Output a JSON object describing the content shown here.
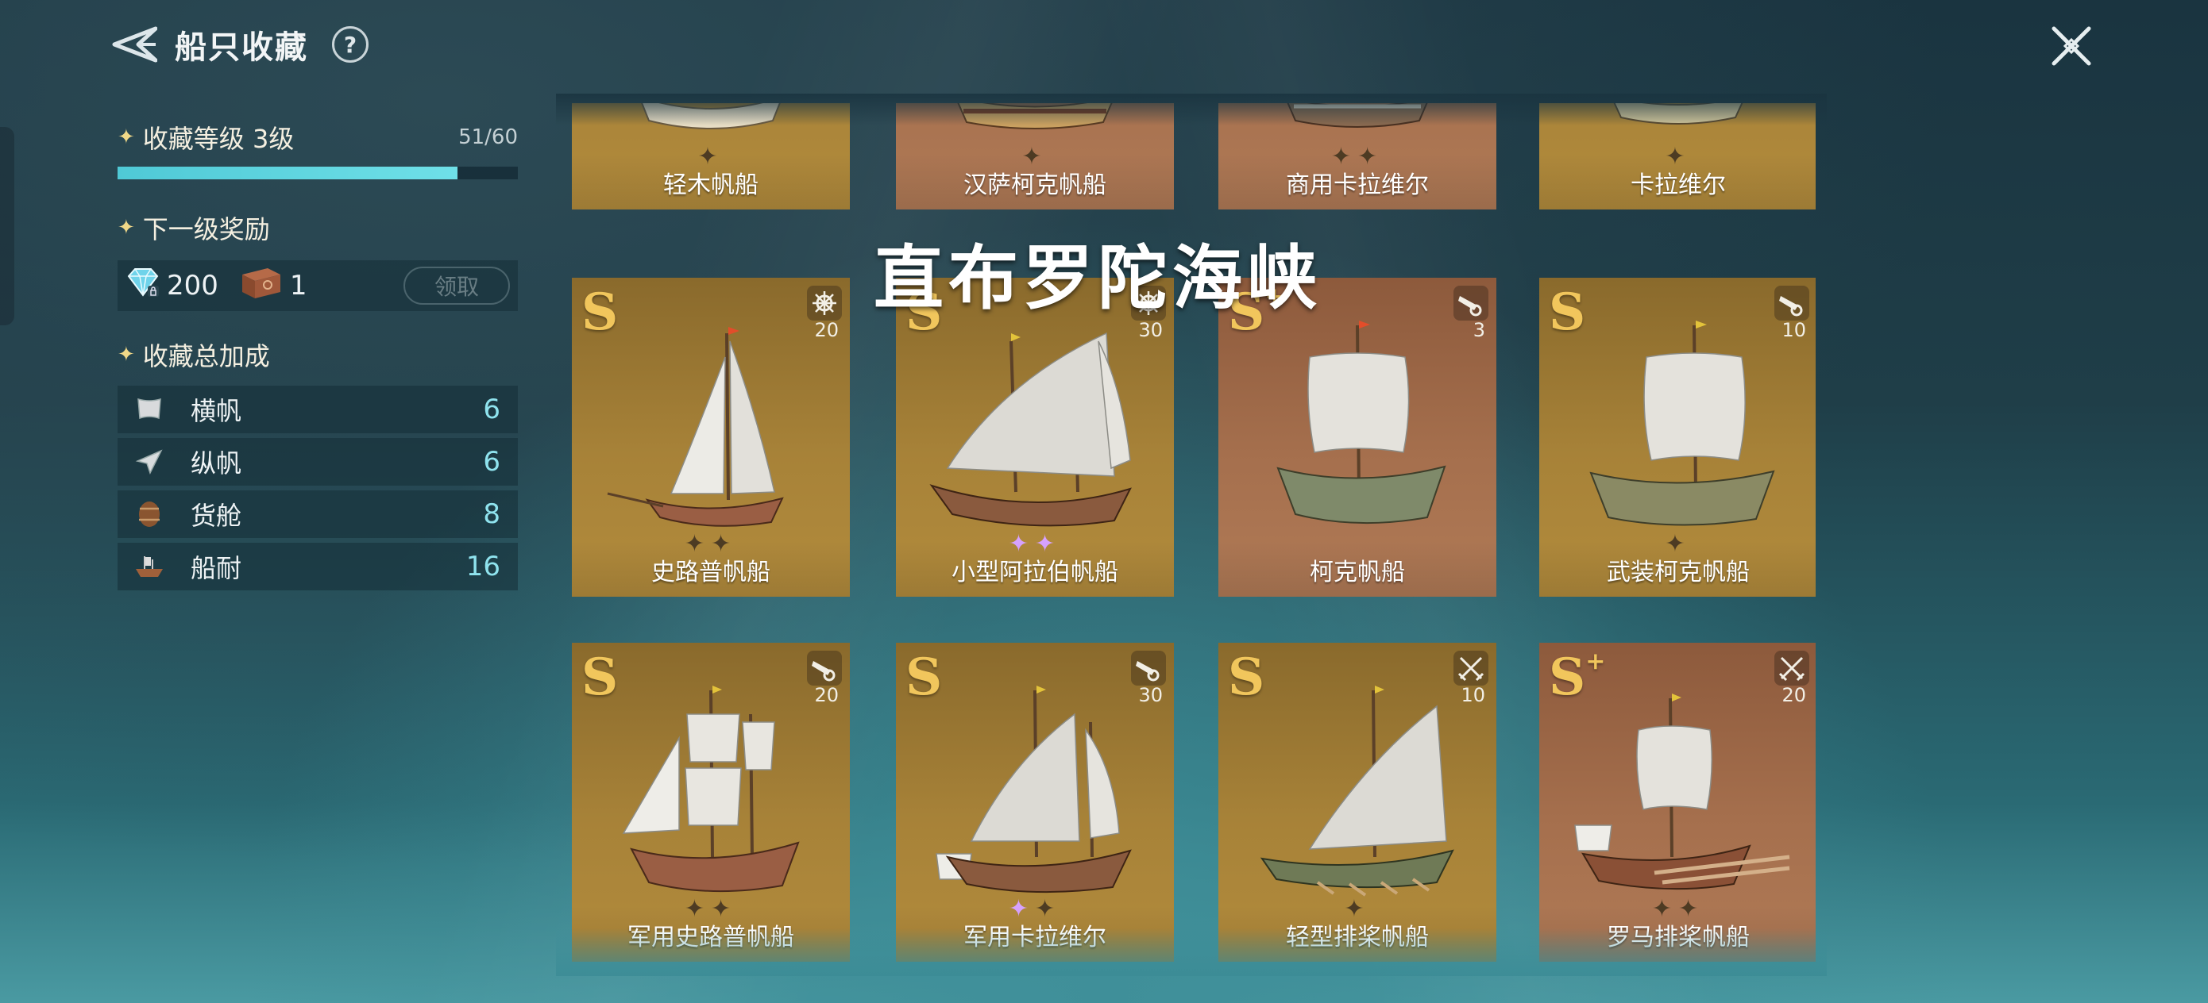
{
  "header": {
    "title": "船只收藏",
    "help": "?"
  },
  "collection": {
    "level_label": "收藏等级 3级",
    "level_count": "51/60",
    "progress": 0.85,
    "next_reward_label": "下一级奖励",
    "rewards": [
      {
        "icon": "diamond-icon",
        "amount": "200"
      },
      {
        "icon": "chest-icon",
        "amount": "1"
      }
    ],
    "claim_label": "领取",
    "bonus_label": "收藏总加成",
    "bonus": [
      {
        "icon": "square-sail-icon",
        "label": "横帆",
        "value": "6"
      },
      {
        "icon": "fore-aft-sail-icon",
        "label": "纵帆",
        "value": "6"
      },
      {
        "icon": "barrel-icon",
        "label": "货舱",
        "value": "8"
      },
      {
        "icon": "ship-hull-icon",
        "label": "船耐",
        "value": "16"
      }
    ]
  },
  "overlay": {
    "location": "直布罗陀海峡"
  },
  "ships": {
    "row0": [
      {
        "name": "轻木帆船",
        "stars": "✦"
      },
      {
        "name": "汉萨柯克帆船",
        "stars": "✦"
      },
      {
        "name": "商用卡拉维尔",
        "stars": "✦✦"
      },
      {
        "name": "卡拉维尔",
        "stars": "✦"
      }
    ],
    "row1": [
      {
        "grade": "S",
        "plus": "",
        "type_icon": "helm-icon",
        "type_num": "20",
        "name": "史路普帆船",
        "stars": "✦✦"
      },
      {
        "grade": "S",
        "plus": "",
        "type_icon": "helm-icon",
        "type_num": "30",
        "name": "小型阿拉伯帆船",
        "stars": "✦✦"
      },
      {
        "grade": "S",
        "plus": "+",
        "type_icon": "cannon-icon",
        "type_num": "3",
        "name": "柯克帆船",
        "stars": ""
      },
      {
        "grade": "S",
        "plus": "",
        "type_icon": "cannon-icon",
        "type_num": "10",
        "name": "武装柯克帆船",
        "stars": "✦"
      }
    ],
    "row2": [
      {
        "grade": "S",
        "plus": "",
        "type_icon": "cannon-icon",
        "type_num": "20",
        "name": "军用史路普帆船",
        "stars": "✦✦"
      },
      {
        "grade": "S",
        "plus": "",
        "type_icon": "cannon-icon",
        "type_num": "30",
        "name": "军用卡拉维尔",
        "stars": "✦✦"
      },
      {
        "grade": "S",
        "plus": "",
        "type_icon": "crossed-swords-icon",
        "type_num": "10",
        "name": "轻型排桨帆船",
        "stars": "✦"
      },
      {
        "grade": "S",
        "plus": "+",
        "type_icon": "crossed-swords-icon",
        "type_num": "20",
        "name": "罗马排桨帆船",
        "stars": "✦✦"
      }
    ]
  },
  "colors": {
    "accent": "#6fe0e8",
    "grade": "#f1c65c",
    "card_gold": "#a78238",
    "card_brown": "#a56f4d"
  }
}
